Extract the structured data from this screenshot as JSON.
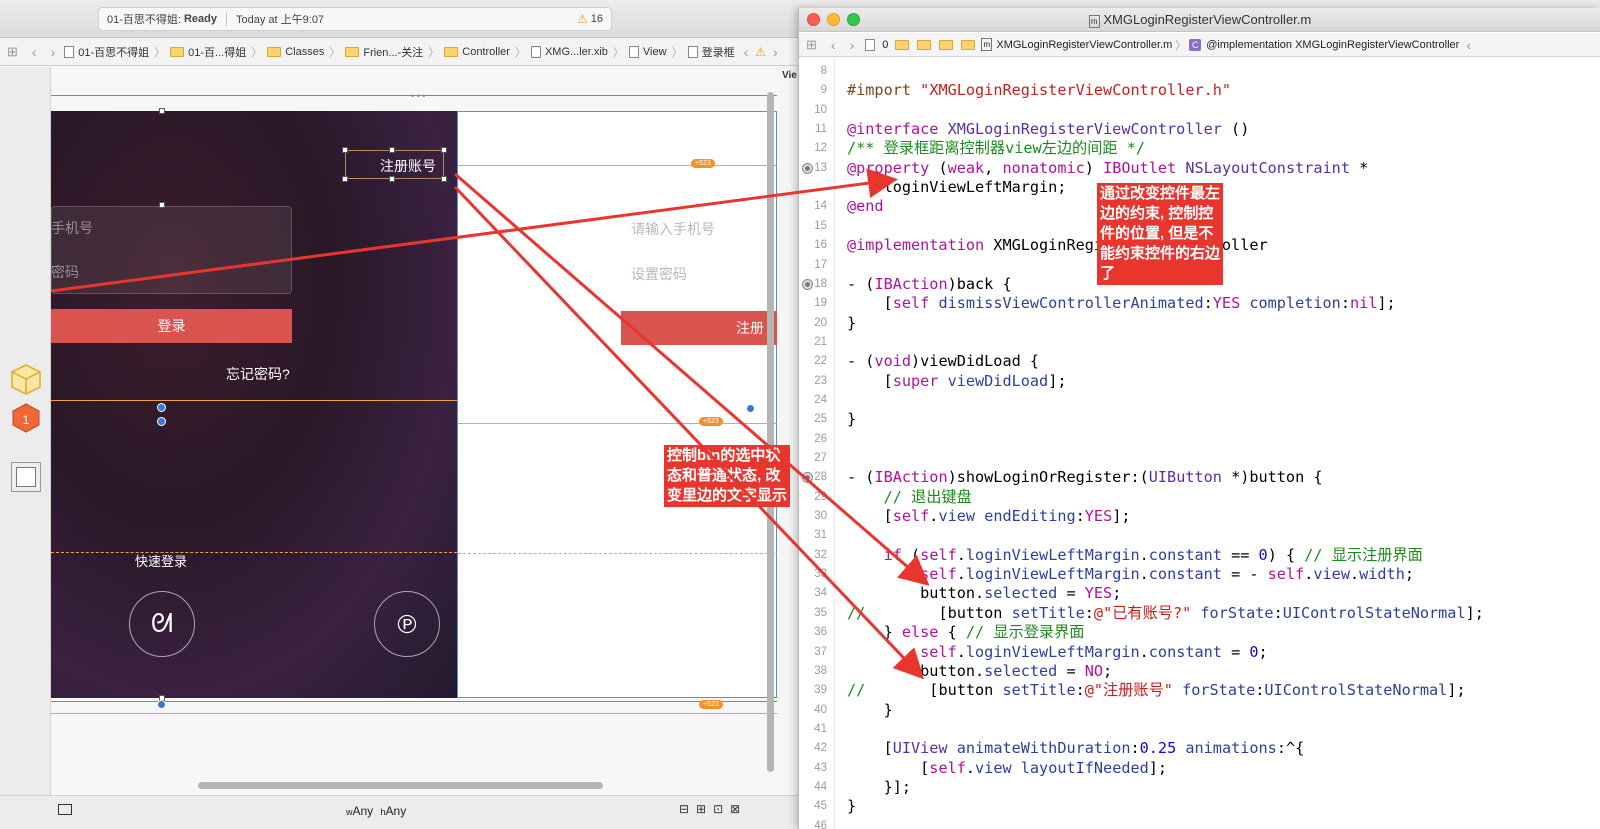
{
  "left_window": {
    "activity": {
      "project": "01-百思不得姐:",
      "status": "Ready",
      "time": "Today at 上午9:07",
      "warning_count": "16"
    },
    "jumpbar": [
      {
        "label": "01-百思不得姐",
        "icon": "file-icon"
      },
      {
        "label": "01-百...得姐",
        "icon": "folder-icon"
      },
      {
        "label": "Classes",
        "icon": "folder-icon"
      },
      {
        "label": "Frien...-关注",
        "icon": "folder-icon"
      },
      {
        "label": "Controller",
        "icon": "folder-icon"
      },
      {
        "label": "XMG...ler.xib",
        "icon": "xib-icon"
      },
      {
        "label": "View",
        "icon": "view-icon"
      },
      {
        "label": "登录框",
        "icon": "view-icon"
      }
    ],
    "login_scene": {
      "register_button": "注册账号",
      "phone_placeholder": "手机号",
      "password_placeholder": "密码",
      "login_button": "登录",
      "forgot_password": "忘记密码?",
      "quick_login": "快速登录"
    },
    "register_scene": {
      "phone_placeholder": "请输入手机号",
      "password_placeholder": "设置密码",
      "register_button": "注册"
    },
    "constraint_badge": "+523",
    "size_class": {
      "w_label": "w",
      "w_value": "Any",
      "h_label": "h",
      "h_value": "Any"
    },
    "side_label": "Vie"
  },
  "right_window": {
    "title": "XMGLoginRegisterViewController.m",
    "jumpbar": {
      "counter": "0",
      "file": "XMGLoginRegisterViewController.m",
      "symbol": "@implementation XMGLoginRegisterViewController"
    }
  },
  "code_lines": [
    {
      "n": "8",
      "html": ""
    },
    {
      "n": "9",
      "html": "<span class='pp'>#import</span> <span class='str'>\"XMGLoginRegisterViewController.h\"</span>"
    },
    {
      "n": "10",
      "html": ""
    },
    {
      "n": "11",
      "html": "<span class='kw'>@interface</span> <span class='cls'>XMGLoginRegisterViewController</span> ()"
    },
    {
      "n": "12",
      "html": "<span class='cm'>/** 登录框距离控制器view左边的间距 */</span>"
    },
    {
      "n": "13",
      "html": "<span class='kw'>@property</span> (<span class='kw'>weak</span>, <span class='kw'>nonatomic</span>) <span class='kw'>IBOutlet</span> <span class='cls'>NSLayoutConstraint</span> *",
      "bp": true
    },
    {
      "n": "",
      "html": "    loginViewLeftMargin;"
    },
    {
      "n": "14",
      "html": "<span class='kw'>@end</span>"
    },
    {
      "n": "15",
      "html": ""
    },
    {
      "n": "16",
      "html": "<span class='kw'>@implementation</span> XMGLoginRegisterViewController"
    },
    {
      "n": "17",
      "html": ""
    },
    {
      "n": "18",
      "html": "- (<span class='kw'>IBAction</span>)back {",
      "bp": true
    },
    {
      "n": "19",
      "html": "    [<span class='kw'>self</span> <span class='mt'>dismissViewControllerAnimated</span>:<span class='kw'>YES</span> <span class='mt'>completion</span>:<span class='kw'>nil</span>];"
    },
    {
      "n": "20",
      "html": "}"
    },
    {
      "n": "21",
      "html": ""
    },
    {
      "n": "22",
      "html": "- (<span class='kw'>void</span>)viewDidLoad {"
    },
    {
      "n": "23",
      "html": "    [<span class='kw'>super</span> <span class='mt'>viewDidLoad</span>];"
    },
    {
      "n": "24",
      "html": ""
    },
    {
      "n": "25",
      "html": "}"
    },
    {
      "n": "26",
      "html": ""
    },
    {
      "n": "27",
      "html": ""
    },
    {
      "n": "28",
      "html": "- (<span class='kw'>IBAction</span>)showLoginOrRegister:(<span class='cls'>UIButton</span> *)button {",
      "bp": true
    },
    {
      "n": "29",
      "html": "    <span class='cm'>// 退出键盘</span>"
    },
    {
      "n": "30",
      "html": "    [<span class='kw'>self</span>.<span class='mt'>view</span> <span class='mt'>endEditing</span>:<span class='kw'>YES</span>];"
    },
    {
      "n": "31",
      "html": ""
    },
    {
      "n": "32",
      "html": "    <span class='kw'>if</span> (<span class='kw'>self</span>.<span class='mt'>loginViewLeftMargin</span>.<span class='mt'>constant</span> == <span class='num'>0</span>) { <span class='cm'>// 显示注册界面</span>"
    },
    {
      "n": "33",
      "html": "        <span class='kw'>self</span>.<span class='mt'>loginViewLeftMargin</span>.<span class='mt'>constant</span> = - <span class='kw'>self</span>.<span class='mt'>view</span>.<span class='mt'>width</span>;"
    },
    {
      "n": "34",
      "html": "        button.<span class='mt'>selected</span> = <span class='kw'>YES</span>;"
    },
    {
      "n": "35",
      "html": "<span class='cm'>//</span>        [button <span class='mt'>setTitle</span>:<span class='str'>@\"已有账号?\"</span> <span class='mt'>forState</span>:<span class='mt'>UIControlStateNormal</span>];"
    },
    {
      "n": "36",
      "html": "    } <span class='kw'>else</span> { <span class='cm'>// 显示登录界面</span>"
    },
    {
      "n": "37",
      "html": "        <span class='kw'>self</span>.<span class='mt'>loginViewLeftMargin</span>.<span class='mt'>constant</span> = <span class='num'>0</span>;"
    },
    {
      "n": "38",
      "html": "        button.<span class='mt'>selected</span> = <span class='kw'>NO</span>;"
    },
    {
      "n": "39",
      "html": "<span class='cm'>//</span>       [button <span class='mt'>setTitle</span>:<span class='str'>@\"注册账号\"</span> <span class='mt'>forState</span>:<span class='mt'>UIControlStateNormal</span>];"
    },
    {
      "n": "40",
      "html": "    }"
    },
    {
      "n": "41",
      "html": ""
    },
    {
      "n": "42",
      "html": "    [<span class='cls'>UIView</span> <span class='mt'>animateWithDuration</span>:<span class='num'>0.25</span> <span class='mt'>animations</span>:^{"
    },
    {
      "n": "43",
      "html": "        [<span class='kw'>self</span>.<span class='mt'>view</span> <span class='mt'>layoutIfNeeded</span>];"
    },
    {
      "n": "44",
      "html": "    }];"
    },
    {
      "n": "45",
      "html": "}"
    },
    {
      "n": "46",
      "html": ""
    }
  ],
  "annotations": {
    "constraint_note": [
      "通过改变控件最左",
      "边的约束, 控制控",
      "件的位置, 但是不",
      "能约束控件的右边",
      "了"
    ],
    "button_note": [
      "控制btn的选中状",
      "态和普通状态, 改",
      "变里边的文字显示"
    ]
  },
  "colors": {
    "accent_red": "#e8352d",
    "button_red": "#d9534f",
    "constraint_orange": "#f2a243",
    "selection_blue": "#5a8fd6"
  }
}
